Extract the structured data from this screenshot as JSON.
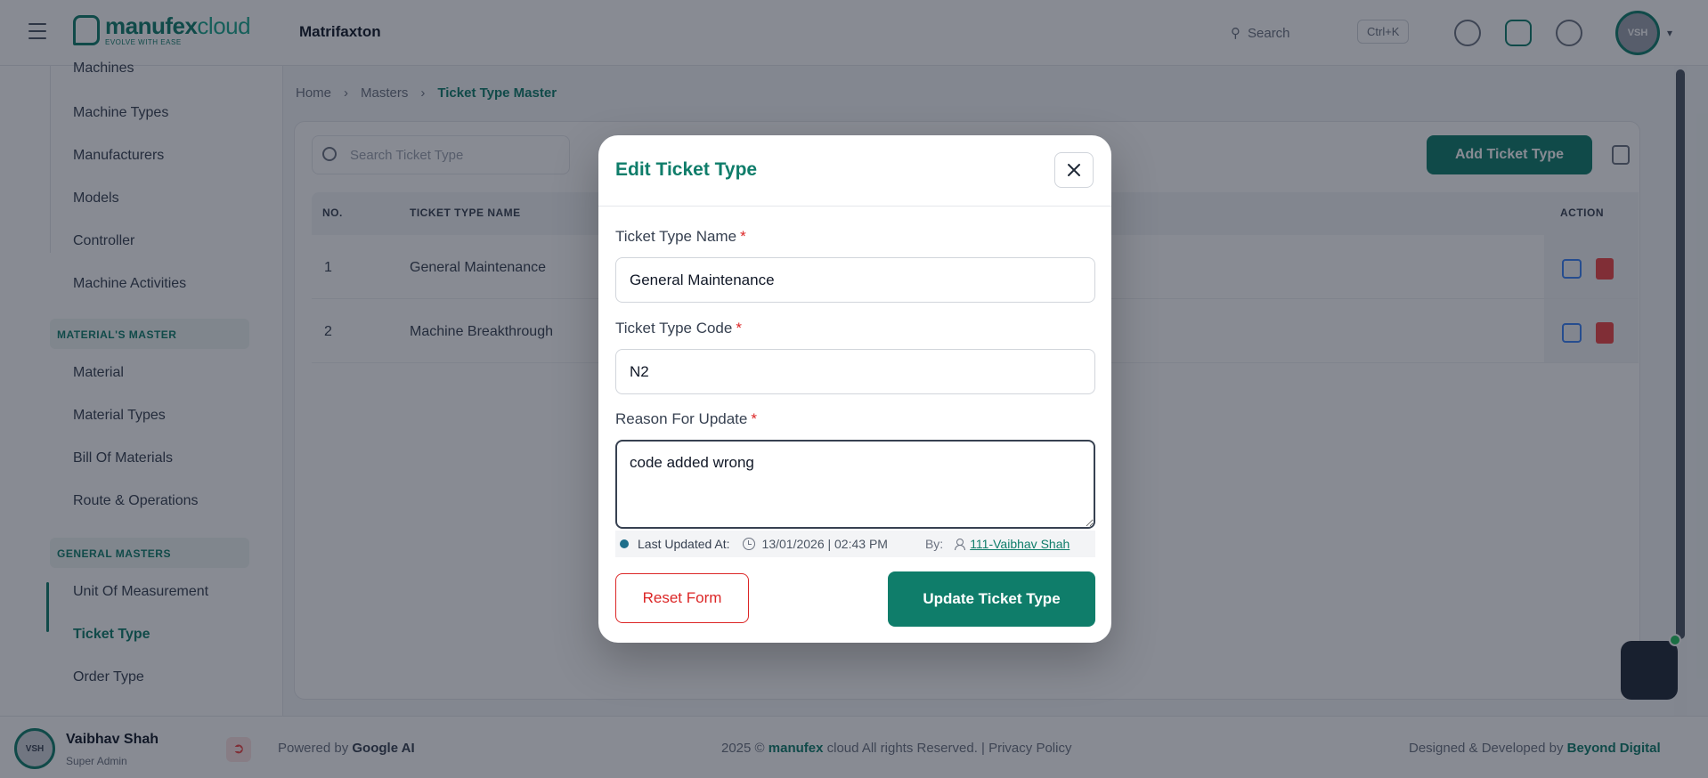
{
  "topbar": {
    "logo_name": "manufex",
    "logo_suffix": "cloud",
    "logo_tagline": "EVOLVE WITH EASE",
    "page_title": "Matrifaxton",
    "search_placeholder": "Search",
    "search_shortcut": "Ctrl+K",
    "user_initials": "VSH"
  },
  "sidebar": {
    "items_top": [
      "Machines",
      "Machine Types",
      "Manufacturers",
      "Models",
      "Controller",
      "Machine Activities"
    ],
    "group_material": "MATERIAL'S MASTER",
    "items_material": [
      "Material",
      "Material Types",
      "Bill Of Materials",
      "Route & Operations"
    ],
    "group_general": "GENERAL MASTERS",
    "items_general": [
      "Unit Of Measurement",
      "Ticket Type",
      "Order Type"
    ]
  },
  "breadcrumb": {
    "items": [
      "Home",
      "Masters",
      "Ticket Type Master"
    ]
  },
  "list": {
    "search_placeholder": "Search Ticket Type",
    "add_label": "Add Ticket Type",
    "columns": [
      "NO.",
      "TICKET TYPE NAME",
      "ACTION"
    ],
    "rows": [
      {
        "no": "1",
        "name": "General Maintenance"
      },
      {
        "no": "2",
        "name": "Machine Breakthrough"
      }
    ]
  },
  "footer": {
    "user_initials": "VSH",
    "user_name": "Vaibhav Shah",
    "user_role": "Super Admin",
    "powered_by": "Powered by",
    "powered_brand": "Google AI",
    "copyright_prefix": "2025 ©",
    "copyright_brand": "manufex",
    "copyright_suffix": "cloud All rights Reserved. | Privacy Policy",
    "designed_by": "Designed & Developed by",
    "designed_brand": "Beyond Digital"
  },
  "modal": {
    "title": "Edit Ticket Type",
    "name_label": "Ticket Type Name",
    "name_value": "General Maintenance",
    "code_label": "Ticket Type Code",
    "code_value": "N2",
    "reason_label": "Reason For Update",
    "reason_value": "code added wrong",
    "required_mark": "*",
    "last_updated_label": "Last Updated At:",
    "last_updated_value": "13/01/2026 | 02:43 PM",
    "by_label": "By:",
    "by_user": "111-Vaibhav Shah",
    "reset_label": "Reset Form",
    "update_label": "Update Ticket Type"
  },
  "colors": {
    "brand": "#0f7d6a",
    "danger": "#dc2626",
    "overlay": "rgba(17,24,39,0.5)"
  }
}
